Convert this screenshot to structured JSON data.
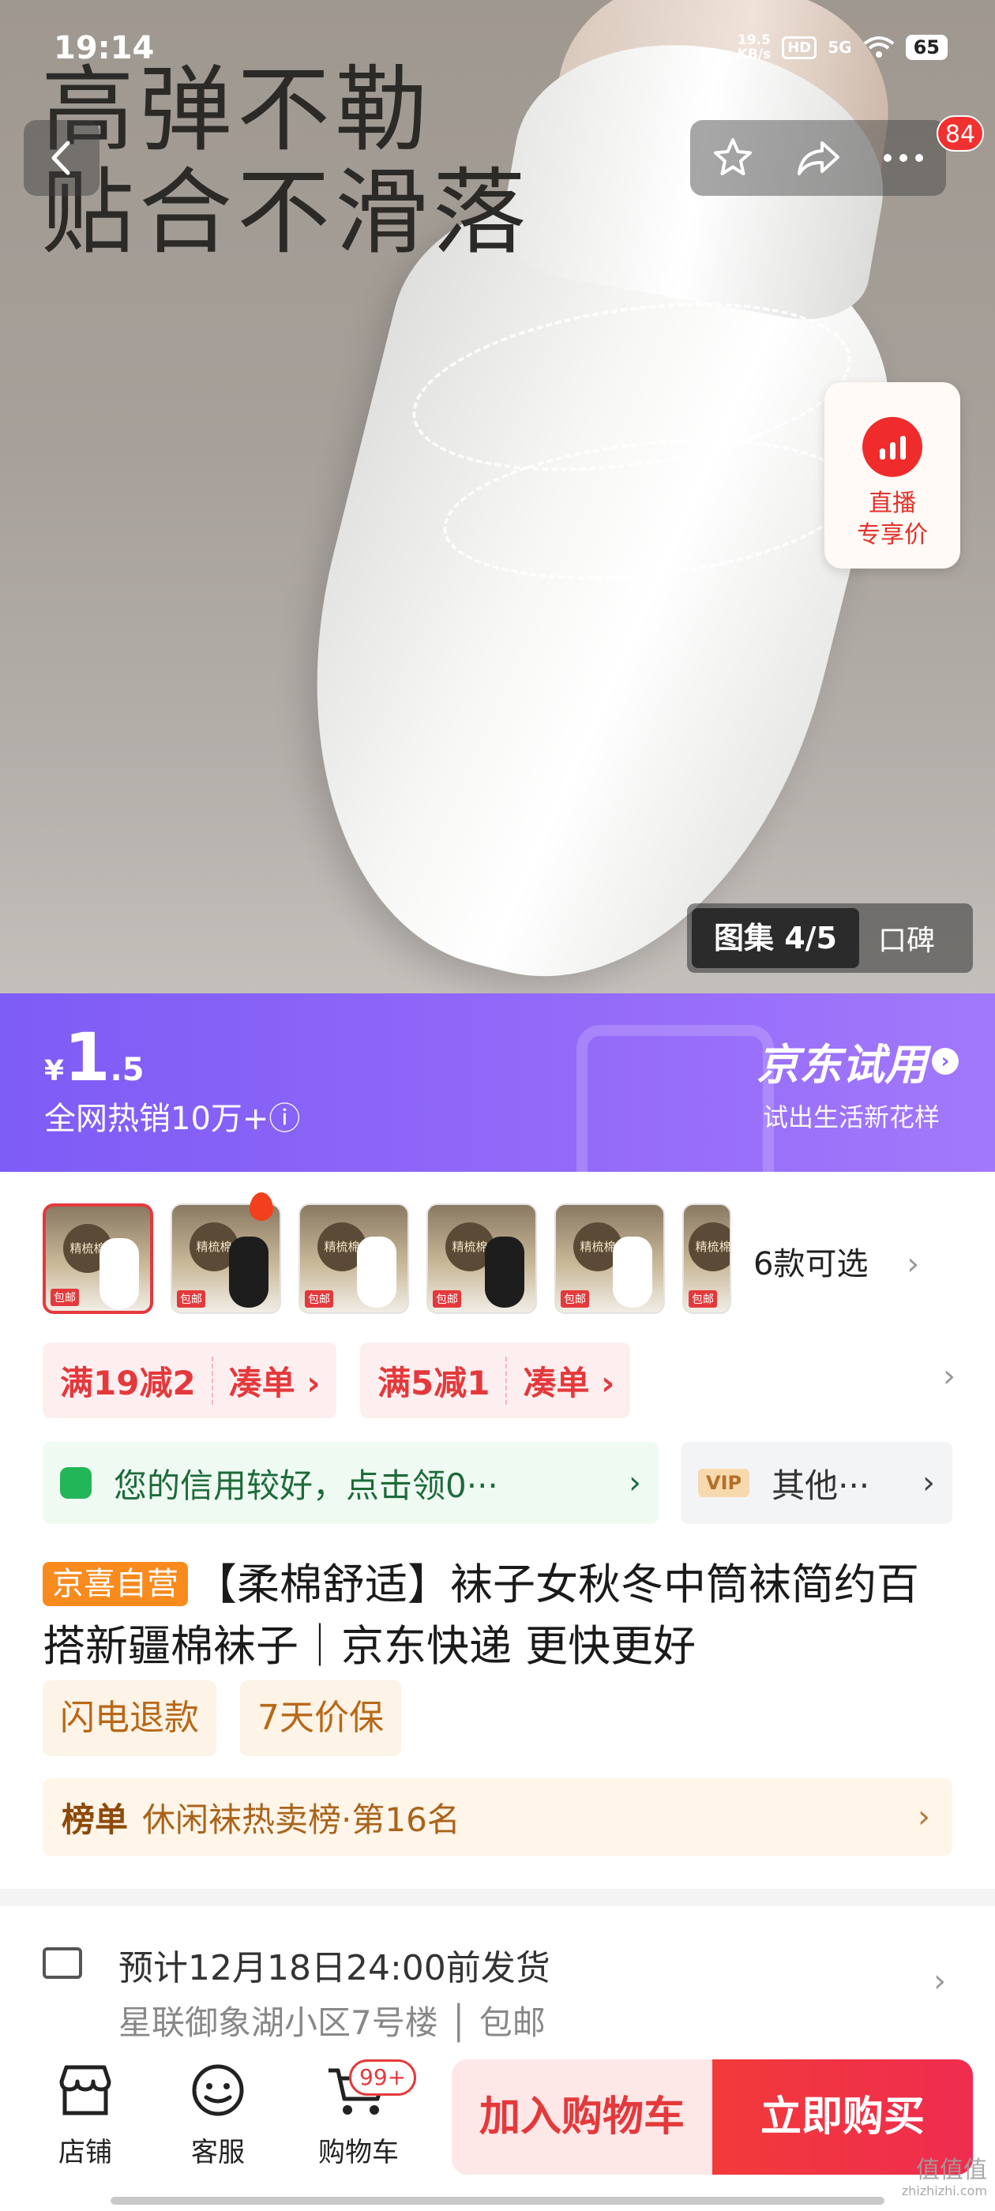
{
  "status_bar": {
    "time": "19:14",
    "net_speed": "19.5",
    "net_unit": "KB/s",
    "hd": "HD",
    "signal": "5G",
    "battery": "65"
  },
  "hero": {
    "slogan_line1": "高弹不勒",
    "slogan_line2": "贴合不滑落",
    "message_count": "84",
    "live_label_line1": "直播",
    "live_label_line2": "专享价",
    "gallery_label": "图集 4/5",
    "reviews_tab": "口碑"
  },
  "price_banner": {
    "currency": "¥",
    "price_int": "1",
    "price_dec": ".5",
    "sales": "全网热销10万+ⓘ",
    "trial_title": "京东试用",
    "trial_arrow": "›",
    "trial_sub": "试出生活新花样"
  },
  "variants": {
    "thumb_label": "精梳棉",
    "thumb_mini": "包邮",
    "count": "6款可选",
    "chevron": "›"
  },
  "coupons": [
    {
      "value": "满19减2",
      "action": "凑单 ›"
    },
    {
      "value": "满5减1",
      "action": "凑单 ›"
    }
  ],
  "credit": {
    "text": "您的信用较好，点击领0···",
    "chevron": "›"
  },
  "vip": {
    "badge": "VIP",
    "text": "其他···",
    "chevron": "›"
  },
  "product": {
    "badge": "京喜自营",
    "title": "【柔棉舒适】袜子女秋冬中筒袜简约百搭新疆棉袜子｜京东快递 更快更好",
    "chips": [
      "闪电退款",
      "7天价保"
    ],
    "rank_label": "榜单",
    "rank_text": "休闲袜热卖榜·第16名"
  },
  "shipping": {
    "line1": "预计12月18日24:00前发货",
    "line2": "星联御象湖小区7号楼 │ 包邮"
  },
  "bottom_bar": {
    "store": "店铺",
    "service": "客服",
    "cart": "购物车",
    "cart_count": "99+",
    "add_to_cart": "加入购物车",
    "buy_now": "立即购买"
  },
  "watermark": {
    "main": "值值值",
    "sub": "zhizhizhi.com"
  },
  "colors": {
    "accent_red": "#e4393c",
    "banner_purple": "#8f66f8",
    "badge_orange": "#f88a1e"
  }
}
